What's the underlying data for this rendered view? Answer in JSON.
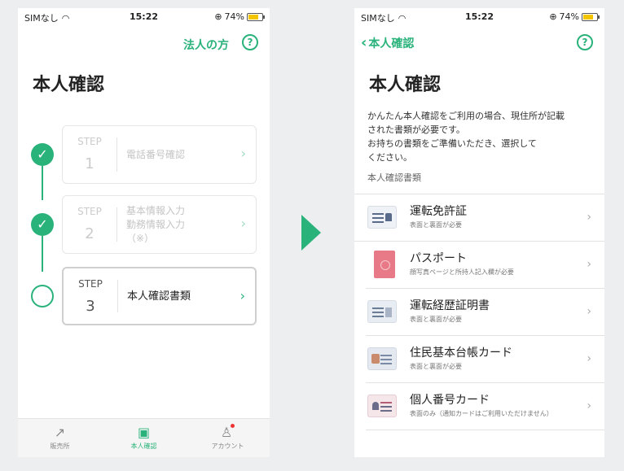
{
  "left_screen": {
    "status": {
      "carrier": "SIMなし",
      "time": "15:22",
      "battery": "74%"
    },
    "nav": {
      "corp_link": "法人の方",
      "help": "?"
    },
    "title": "本人確認",
    "steps": [
      {
        "label": "STEP",
        "number": "1",
        "title": "電話番号確認",
        "state": "done"
      },
      {
        "label": "STEP",
        "number": "2",
        "title_lines": [
          "基本情報入力",
          "勤務情報入力",
          "（※）"
        ],
        "state": "done"
      },
      {
        "label": "STEP",
        "number": "3",
        "title": "本人確認書類",
        "state": "current"
      }
    ],
    "tabs": [
      {
        "label": "販売所",
        "icon": "chart-trend-icon"
      },
      {
        "label": "本人確認",
        "icon": "id-card-icon",
        "active": true
      },
      {
        "label": "アカウント",
        "icon": "user-icon",
        "badge": true
      }
    ]
  },
  "right_screen": {
    "status": {
      "carrier": "SIMなし",
      "time": "15:22",
      "battery": "74%"
    },
    "nav": {
      "back_label": "本人確認",
      "help": "?"
    },
    "title": "本人確認",
    "description_lines": [
      "かんたん本人確認をご利用の場合、現住所が記載",
      "された書類が必要です。",
      "お持ちの書類をご準備いただき、選択して",
      "ください。"
    ],
    "section_label": "本人確認書類",
    "documents": [
      {
        "name": "運転免許証",
        "sub": "表面と裏面が必要",
        "icon": "drivers-license-icon"
      },
      {
        "name": "パスポート",
        "sub": "顔写真ページと所持人記入欄が必要",
        "icon": "passport-icon"
      },
      {
        "name": "運転経歴証明書",
        "sub": "表面と裏面が必要",
        "icon": "driving-history-certificate-icon"
      },
      {
        "name": "住民基本台帳カード",
        "sub": "表面と裏面が必要",
        "icon": "resident-card-icon"
      },
      {
        "name": "個人番号カード",
        "sub": "表面のみ（通知カードはご利用いただけません）",
        "icon": "my-number-card-icon"
      }
    ]
  },
  "colors": {
    "accent": "#2ab27b",
    "background": "#eceeef"
  }
}
